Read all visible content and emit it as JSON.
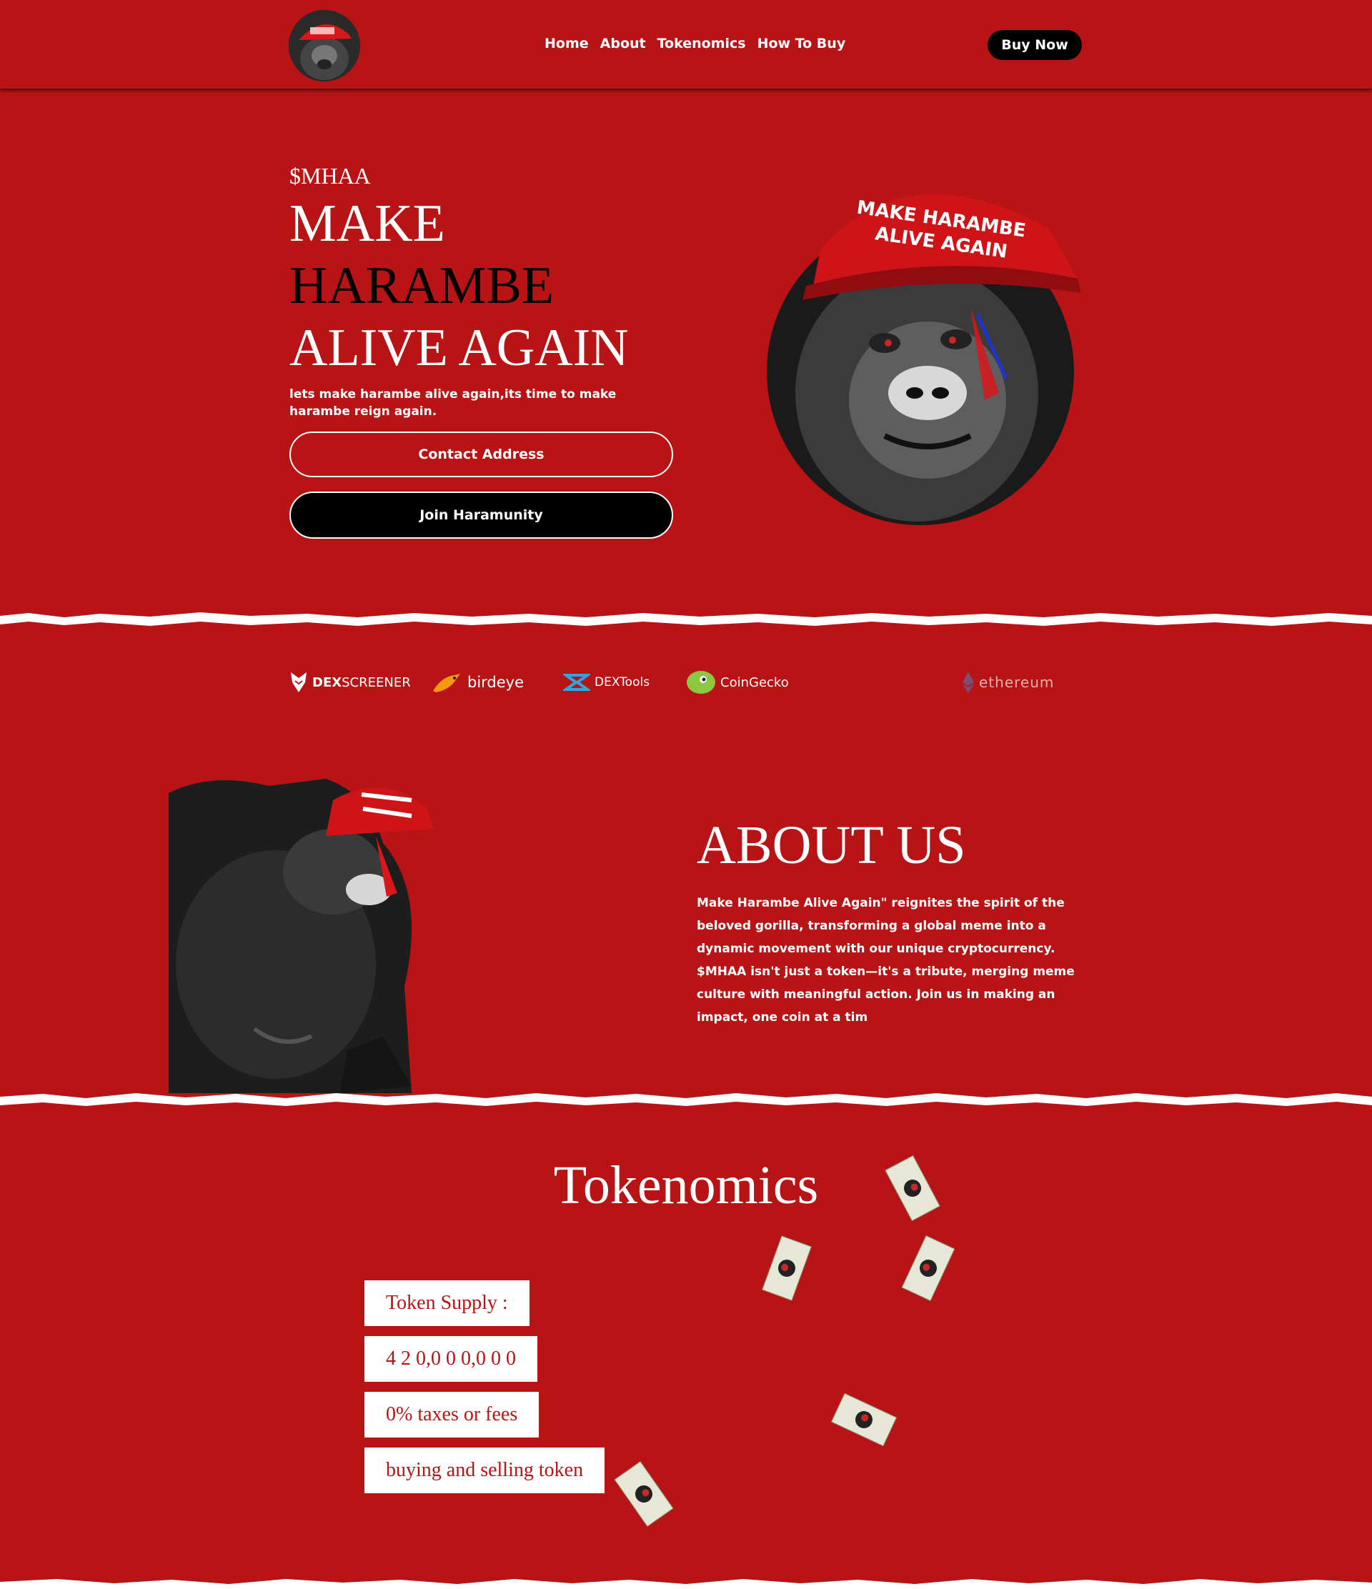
{
  "nav": {
    "links": [
      "Home",
      "About",
      "Tokenomics",
      "How To Buy"
    ],
    "buy_label": "Buy Now"
  },
  "hero": {
    "ticker": "$MHAA",
    "title_lines": [
      "MAKE",
      "HARAMBE",
      "ALIVE AGAIN"
    ],
    "subtitle": "lets make harambe alive again,its time to make harambe reign again.",
    "contact_label": "Contact Address",
    "join_label": "Join Haramunity",
    "cap_text": [
      "MAKE HARAMBE",
      "ALIVE AGAIN"
    ]
  },
  "partners": [
    {
      "name": "DEXSCREENER",
      "bold": "DEX",
      "rest": "SCREENER"
    },
    {
      "name": "birdeye"
    },
    {
      "name": "DEXTools"
    },
    {
      "name": "CoinGecko"
    },
    {
      "name": "ethereum"
    }
  ],
  "about": {
    "title": "ABOUT US",
    "text": "Make Harambe Alive Again\" reignites the spirit of the beloved gorilla, transforming a global meme into a dynamic movement with our unique cryptocurrency. $MHAA isn't just a token—it's a tribute, merging meme culture with meaningful action. Join us in making an impact, one coin at a tim"
  },
  "tokenomics": {
    "title": "Tokenomics",
    "items": [
      "Token Supply :",
      "4 2 0,0 0 0,0 0 0",
      "0% taxes or fees",
      "buying and selling token"
    ]
  },
  "colors": {
    "background": "#b81416",
    "dark": "#000000",
    "light": "#ffffff"
  }
}
